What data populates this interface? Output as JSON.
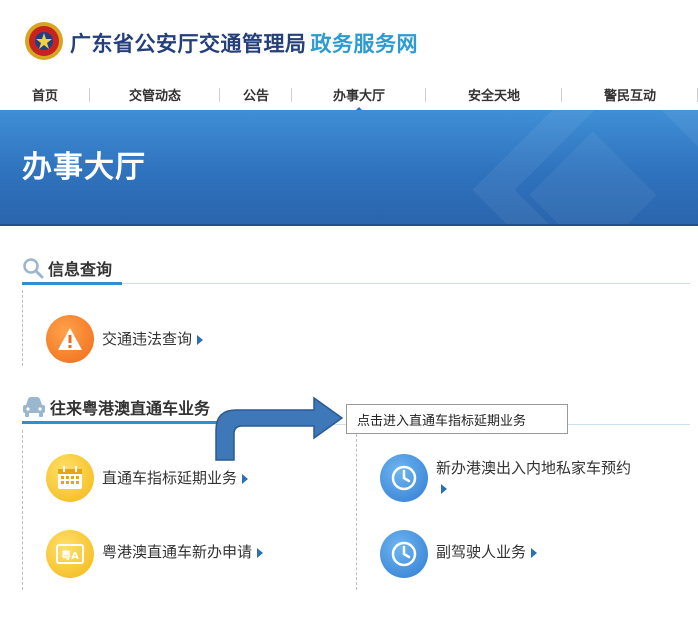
{
  "header": {
    "title_main": "广东省公安厅交通管理局",
    "title_accent": "政务服务网",
    "emblem_icon": "police-emblem-icon"
  },
  "nav": {
    "items": [
      {
        "label": "首页"
      },
      {
        "label": "交管动态"
      },
      {
        "label": "公告"
      },
      {
        "label": "办事大厅"
      },
      {
        "label": "安全天地"
      },
      {
        "label": "警民互动"
      }
    ],
    "active_index": 3
  },
  "banner": {
    "title": "办事大厅"
  },
  "sections": {
    "info_query": {
      "title": "信息查询",
      "icon": "search-icon",
      "items": [
        {
          "label": "交通违法查询",
          "icon": "warning-icon"
        }
      ]
    },
    "hk_macau": {
      "title": "往来粤港澳直通车业务",
      "icon": "car-icon",
      "items": [
        {
          "label": "直通车指标延期业务",
          "icon": "calendar-icon"
        },
        {
          "label": "新办港澳出入内地私家车预约",
          "icon": "clock-icon"
        },
        {
          "label": "粤港澳直通车新办申请",
          "icon": "id-card-icon",
          "icon_text": "粤A"
        },
        {
          "label": "副驾驶人业务",
          "icon": "clock-icon"
        }
      ]
    }
  },
  "annotation": {
    "callout_text": "点击进入直通车指标延期业务"
  },
  "colors": {
    "brand_dark": "#243f7a",
    "brand_accent": "#2d9bd2",
    "banner_blue": "#2f72bd",
    "link_arrow": "#2d6eb6"
  }
}
